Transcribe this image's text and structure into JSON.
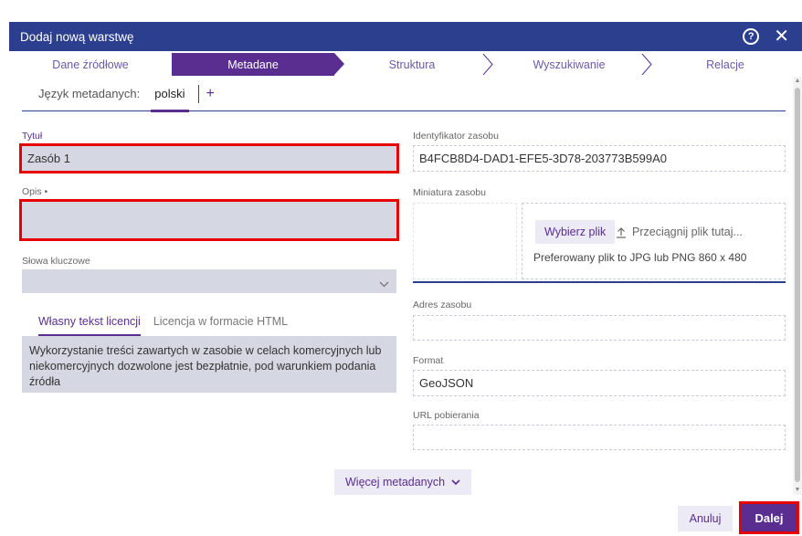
{
  "dialog": {
    "title": "Dodaj nową warstwę"
  },
  "steps": [
    {
      "label": "Dane źródłowe"
    },
    {
      "label": "Metadane"
    },
    {
      "label": "Struktura"
    },
    {
      "label": "Wyszukiwanie"
    },
    {
      "label": "Relacje"
    }
  ],
  "language": {
    "label": "Język metadanych:",
    "current": "polski",
    "add": "+"
  },
  "left": {
    "title_label": "Tytuł",
    "title_value": "Zasób 1",
    "desc_label": "Opis •",
    "desc_value": "",
    "keywords_label": "Słowa kluczowe",
    "keywords_value": "",
    "license_tabs": [
      "Własny tekst licencji",
      "Licencja w formacie HTML"
    ],
    "license_text": "Wykorzystanie treści zawartych w zasobie w celach komercyjnych lub niekomercyjnych dozwolone jest bezpłatnie, pod warunkiem podania źródła"
  },
  "right": {
    "identifier_label": "Identyfikator zasobu",
    "identifier_value": "B4FCB8D4-DAD1-EFE5-3D78-203773B599A0",
    "thumb_label": "Miniatura zasobu",
    "choose_file": "Wybierz plik",
    "drag_text": "Przeciągnij plik tutaj...",
    "preferred": "Preferowany plik to JPG lub PNG 860 x 480",
    "address_label": "Adres zasobu",
    "address_value": "",
    "format_label": "Format",
    "format_value": "GeoJSON",
    "url_label": "URL pobierania",
    "url_value": ""
  },
  "more": "Więcej metadanych",
  "footer": {
    "cancel": "Anuluj",
    "next": "Dalej"
  },
  "colors": {
    "header": "#2c3f8f",
    "accent": "#5a2d91",
    "field": "#d5d8e3",
    "highlight": "#e60000"
  }
}
